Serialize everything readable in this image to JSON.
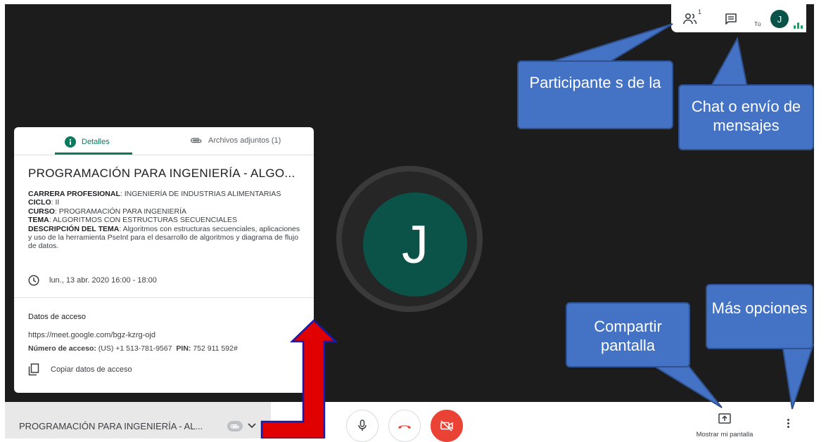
{
  "topbar": {
    "participant_count": "1",
    "self_label": "Tú",
    "self_initial": "J"
  },
  "main": {
    "avatar_initial": "J"
  },
  "details_card": {
    "tabs": [
      {
        "label": "Detalles"
      },
      {
        "label": "Archivos adjuntos (1)"
      }
    ],
    "title": "PROGRAMACIÓN PARA INGENIERÍA - ALGO...",
    "fields": [
      {
        "key": "CARRERA PROFESIONAL",
        "value": ": INGENIERÍA DE INDUSTRIAS ALIMENTARIAS"
      },
      {
        "key": "CICLO",
        "value": ": II"
      },
      {
        "key": "CURSO",
        "value": ": PROGRAMACIÓN PARA INGENIERÍA"
      },
      {
        "key": "TEMA",
        "value": ": ALGORITMOS CON ESTRUCTURAS SECUENCIALES"
      },
      {
        "key": "DESCRIPCIÓN DEL TEMA",
        "value": ": Algoritmos con estructuras secuenciales, aplicaciones y uso de la herramienta PseInt para el desarrollo de algoritmos y diagrama de flujo de datos."
      }
    ],
    "datetime": "lun., 13 abr. 2020 16:00 - 18:00",
    "access": {
      "heading": "Datos de acceso",
      "url": "https://meet.google.com/bgz-kzrg-ojd",
      "number_label": "Número de acceso:",
      "number_value": " (US) +1 513-781-9567",
      "pin_label": "PIN:",
      "pin_value": " 752 911 592#",
      "copy_label": "Copiar datos de acceso"
    }
  },
  "bottom_bar": {
    "meeting_title": "PROGRAMACIÓN PARA INGENIERÍA - AL...",
    "share_label": "Mostrar mi pantalla"
  },
  "annotations": {
    "participants": "Participante s de la",
    "chat": "Chat o envío de mensajes",
    "share": "Compartir pantalla",
    "more": "Más opciones"
  },
  "colors": {
    "stage": "#1c1c1c",
    "avatar": "#0b5348",
    "accent": "#0b7a5f",
    "hangup": "#ea4335",
    "callout": "#4472c4",
    "arrow": "#e00000"
  }
}
